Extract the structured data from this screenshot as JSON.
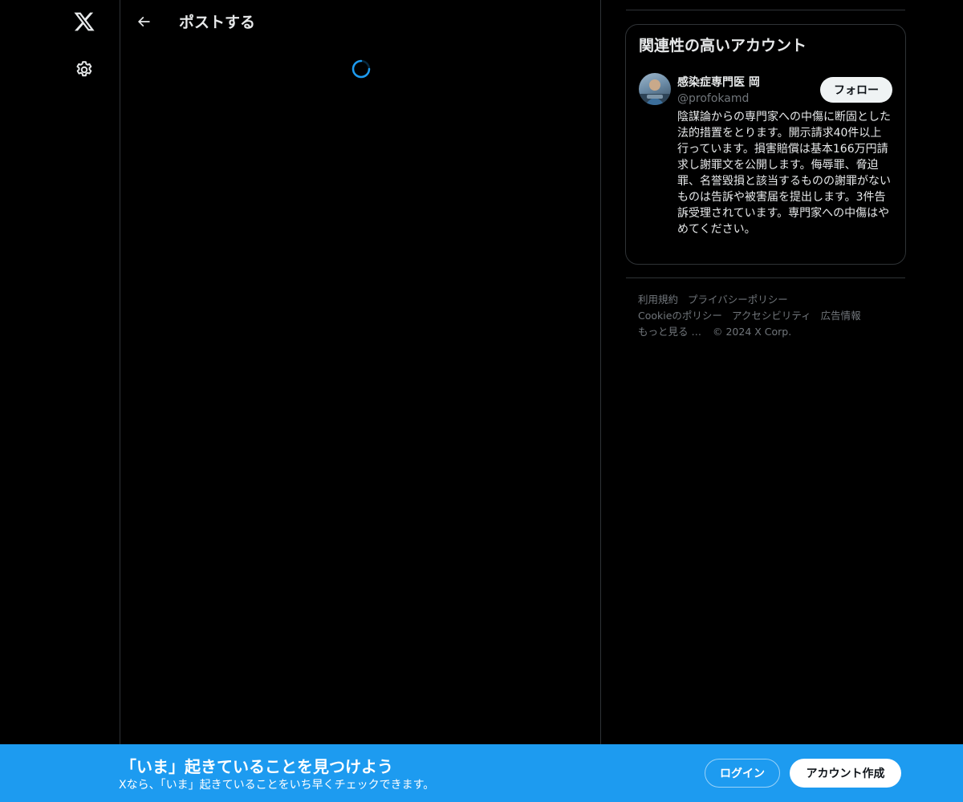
{
  "nav": {
    "logo_icon": "x-logo-icon",
    "settings_icon": "gear-icon"
  },
  "header": {
    "back_icon": "arrow-left-icon",
    "title": "ポストする"
  },
  "main": {
    "loading_icon": "spinner-icon"
  },
  "sidebar": {
    "relevant_title": "関連性の高いアカウント",
    "account": {
      "name": "感染症専門医 岡",
      "handle": "@profokamd",
      "follow_label": "フォロー",
      "bio": "陰謀論からの専門家への中傷に断固とした法的措置をとります。開示請求40件以上行っています。損害賠償は基本166万円請求し謝罪文を公開します。侮辱罪、脅迫罪、名誉毀損と該当するものの謝罪がないものは告訴や被害届を提出します。3件告訴受理されています。専門家への中傷はやめてください。"
    },
    "footer": {
      "terms": "利用規約",
      "privacy": "プライバシーポリシー",
      "cookie": "Cookieのポリシー",
      "accessibility": "アクセシビリティ",
      "ads": "広告情報",
      "more": "もっと見る …",
      "copyright": "© 2024 X Corp."
    }
  },
  "banner": {
    "title": "「いま」起きていることを見つけよう",
    "subtitle": "Xなら、「いま」起きていることをいち早くチェックできます。",
    "login_label": "ログイン",
    "signup_label": "アカウント作成"
  },
  "colors": {
    "background": "#000000",
    "accent": "#1d9bf0",
    "border": "#2f3336",
    "muted_text": "#71767b"
  }
}
